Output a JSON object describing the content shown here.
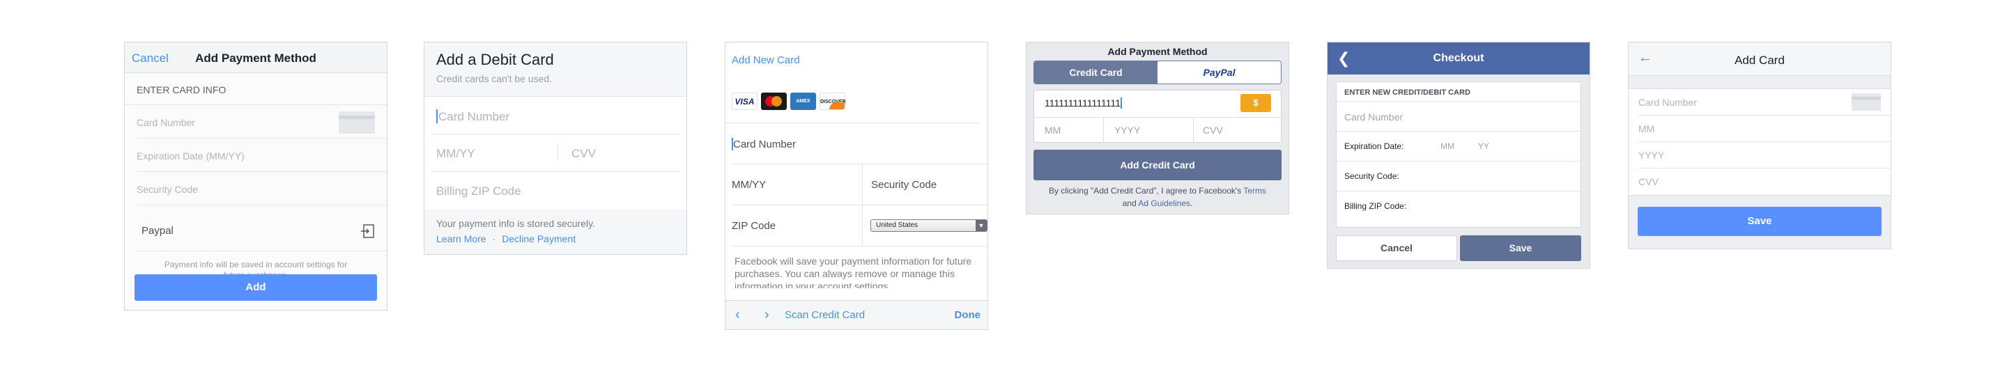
{
  "panel1": {
    "cancel": "Cancel",
    "title": "Add Payment Method",
    "section": "ENTER CARD INFO",
    "card_number": "Card Number",
    "expiration": "Expiration Date (MM/YY)",
    "security": "Security Code",
    "paypal": "Paypal",
    "note": "Payment info will be saved in account settings for future purchases.",
    "add": "Add"
  },
  "panel2": {
    "title": "Add a Debit Card",
    "subtitle": "Credit cards can't be used.",
    "card_number": "Card Number",
    "mmyy": "MM/YY",
    "cvv": "CVV",
    "zip": "Billing ZIP Code",
    "secure_note": "Your payment info is stored securely.",
    "learn_more": "Learn More",
    "dot": "·",
    "decline": "Decline Payment"
  },
  "panel3": {
    "add_new": "Add New Card",
    "logos": {
      "visa": "VISA",
      "amex": "AMEX",
      "discover": "DISCOVER"
    },
    "card_number": "Card Number",
    "mmyy": "MM/YY",
    "security": "Security Code",
    "zip": "ZIP Code",
    "country": "United States",
    "info": "Facebook will save your payment information for future purchases. You can always remove or manage this information in your account settings.",
    "scan": "Scan Credit Card",
    "done": "Done"
  },
  "panel4": {
    "title": "Add Payment Method",
    "tab_credit": "Credit Card",
    "tab_paypal": "PayPal",
    "card_value": "1111111111111111",
    "coin": "$",
    "mm": "MM",
    "yyyy": "YYYY",
    "cvv": "CVV",
    "add": "Add Credit Card",
    "legal_1": "By clicking \"Add Credit Card\", I agree to Facebook's",
    "terms": "Terms",
    "legal_and": "and",
    "ad_guidelines": "Ad Guidelines",
    "legal_end": "."
  },
  "panel5": {
    "title": "Checkout",
    "header": "ENTER NEW CREDIT/DEBIT CARD",
    "card_number": "Card Number",
    "expiration": "Expiration Date:",
    "mm": "MM",
    "yy": "YY",
    "security": "Security Code:",
    "zip": "Billing ZIP Code:",
    "cancel": "Cancel",
    "save": "Save"
  },
  "panel6": {
    "title": "Add Card",
    "card_number": "Card Number",
    "mm": "MM",
    "yyyy": "YYYY",
    "cvv": "CVV",
    "save": "Save"
  }
}
